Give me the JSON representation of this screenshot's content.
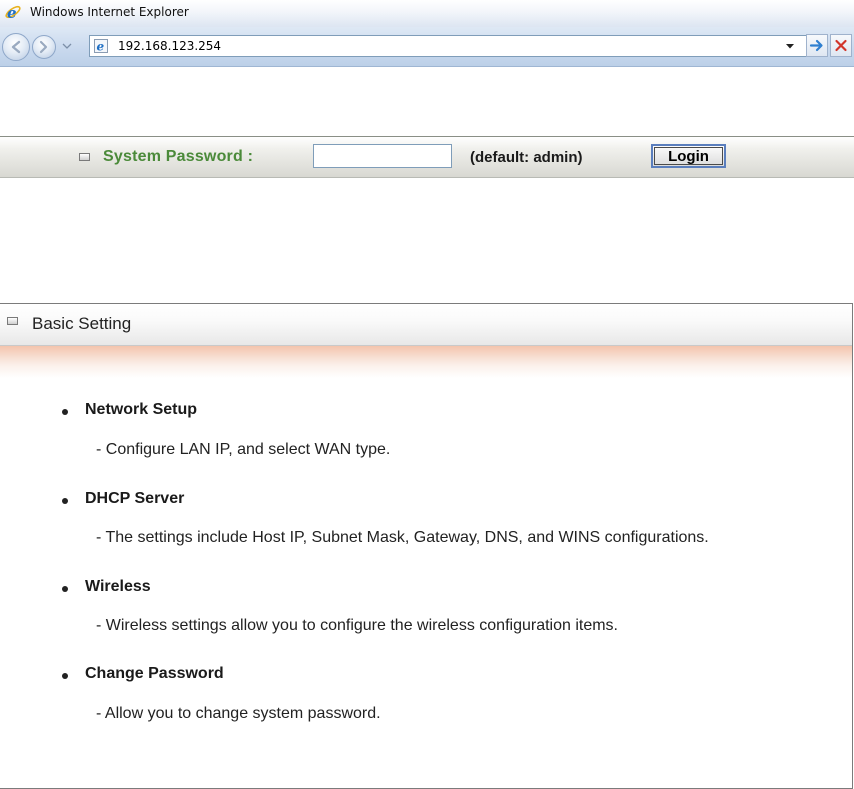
{
  "browser": {
    "title": "Windows Internet Explorer",
    "address": "192.168.123.254"
  },
  "login": {
    "label": "System Password :",
    "password_value": "",
    "hint": "(default: admin)",
    "button_label": "Login"
  },
  "panel": {
    "title": "Basic Setting",
    "items": [
      {
        "title": "Network Setup",
        "description": "- Configure LAN IP, and select WAN type."
      },
      {
        "title": "DHCP Server",
        "description": "- The settings include Host IP, Subnet Mask, Gateway, DNS, and WINS configurations."
      },
      {
        "title": "Wireless",
        "description": "- Wireless settings allow you to configure the wireless configuration items."
      },
      {
        "title": "Change Password",
        "description": "- Allow you to change system password."
      }
    ]
  },
  "colors": {
    "label_green": "#4b8a3a",
    "band_peach": "#f4c4ad",
    "chrome_blue": "#c9d9ee"
  },
  "icons": {
    "browser": "ie-logo-icon",
    "back": "back-arrow-icon",
    "forward": "forward-arrow-icon",
    "go": "go-arrow-icon",
    "stop": "close-x-icon",
    "bullet": "square-bullet-icon"
  }
}
